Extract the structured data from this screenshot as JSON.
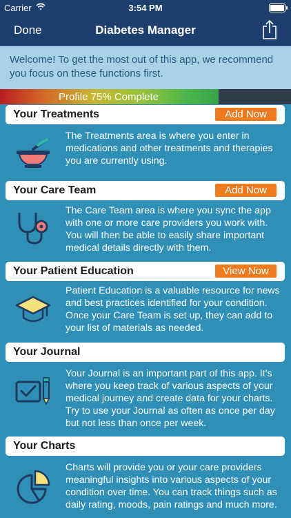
{
  "status_bar": {
    "carrier": "Carrier",
    "time": "3:54 PM"
  },
  "nav": {
    "done_label": "Done",
    "title": "Diabetes Manager"
  },
  "welcome_text": "Welcome! To get the most out of this app, we recommend you focus on these functions first.",
  "profile": {
    "label": "Profile 75% Complete",
    "percent": 75
  },
  "sections": [
    {
      "title": "Your Treatments",
      "button": "Add Now",
      "icon": "mortar-pestle-icon",
      "text": "The Treatments area is where you enter in medications and other treatments and therapies you are currently using."
    },
    {
      "title": "Your Care Team",
      "button": "Add Now",
      "icon": "stethoscope-icon",
      "text": "The Care Team area is where you sync the app with one or more care providers you work with. You will then be able to easily share important medical details directly with them."
    },
    {
      "title": "Your Patient Education",
      "button": "View Now",
      "icon": "graduation-cap-icon",
      "text": "Patient Education is a valuable resource for news and best practices identified for your condition. Once your Care Team is set up, they can add to your list of materials as needed."
    },
    {
      "title": "Your Journal",
      "button": "",
      "icon": "journal-checkbox-pencil-icon",
      "text": "Your Journal is an important part of this app. It's where you keep track of various aspects of your medical journey and create data for your charts. Try to use your Journal as often as once per day but not less than once per week."
    },
    {
      "title": "Your Charts",
      "button": "",
      "icon": "pie-chart-icon",
      "text": "Charts will provide you or your care providers meaningful insights into various aspects of your condition over time. You can track things such as daily rating, moods, pain ratings and much more."
    }
  ],
  "colors": {
    "nav": "#1d3f6e",
    "background": "#2f8fb6",
    "accent_button": "#f07b1f",
    "welcome_bg": "#a8d3e7",
    "icon_navy": "#1f3a5f",
    "icon_teal": "#33b6a6",
    "icon_pink": "#f07b7b",
    "icon_yellow": "#f6e07a"
  }
}
